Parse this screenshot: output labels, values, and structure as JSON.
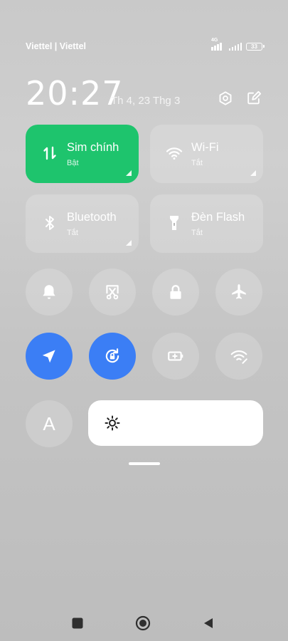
{
  "status_bar": {
    "carrier": "Viettel | Viettel",
    "network_type": "4G",
    "battery": "33"
  },
  "header": {
    "time": "20:27",
    "date": "Th 4, 23 Thg 3"
  },
  "tiles": [
    {
      "title": "Sim chính",
      "subtitle": "Bật",
      "active": true,
      "icon": "mobile-data-icon"
    },
    {
      "title": "Wi-Fi",
      "subtitle": "Tắt",
      "active": false,
      "icon": "wifi-icon"
    },
    {
      "title": "Bluetooth",
      "subtitle": "Tắt",
      "active": false,
      "icon": "bluetooth-icon"
    },
    {
      "title": "Đèn Flash",
      "subtitle": "Tắt",
      "active": false,
      "icon": "flashlight-icon"
    }
  ],
  "toggles_row1": [
    "bell-icon",
    "screenshot-icon",
    "lock-icon",
    "airplane-icon"
  ],
  "toggles_row2": [
    "location-icon",
    "rotation-lock-icon",
    "battery-saver-icon",
    "wifi-hotspot-icon"
  ],
  "auto_brightness_label": "A",
  "brightness_icon": "sun-icon",
  "colors": {
    "active_green": "#1ec46d",
    "active_blue": "#3b7ef5",
    "tile_inactive": "rgba(255,255,255,0.18)"
  },
  "navbar": [
    "recent-apps-icon",
    "home-icon",
    "back-icon"
  ]
}
